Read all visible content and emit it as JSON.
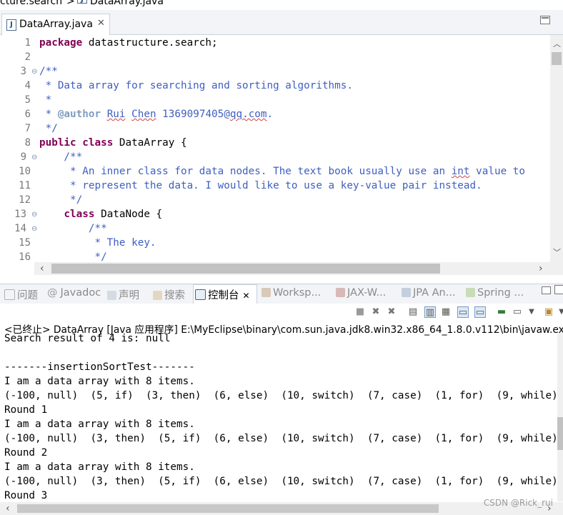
{
  "breadcrumb": {
    "package": "cture.search",
    "separator": ">",
    "file": "DataArray.java"
  },
  "editor_tab": {
    "label": "DataArray.java",
    "close": "✕"
  },
  "code": {
    "line_numbers": [
      "1",
      "2",
      "3",
      "4",
      "5",
      "6",
      "7",
      "8",
      "9",
      "10",
      "11",
      "12",
      "13",
      "14",
      "15",
      "16"
    ],
    "l1": {
      "kw": "package",
      "rest": " datastructure.search;"
    },
    "l3": "/**",
    "l4": " * Data array for searching and sorting algorithms.",
    "l5": " *",
    "l6": {
      "pre": " * ",
      "tag": "@author",
      "sp1": " ",
      "name1": "Rui",
      "sp2": " ",
      "name2": "Chen",
      "mid": " 1369097405@",
      "email": "qq.com",
      "end": "."
    },
    "l7": " */",
    "l8": {
      "kw1": "public",
      "sp": " ",
      "kw2": "class",
      "rest": " DataArray {"
    },
    "l9": "    /**",
    "l10": {
      "pre": "     * An inner class for data nodes. The text book usually use an ",
      "int": "int",
      "post": " value to"
    },
    "l11": "     * represent the data. I would like to use a key-value pair instead.",
    "l12": "     */",
    "l13": {
      "indent": "    ",
      "kw": "class",
      "rest": " DataNode {"
    },
    "l14": "        /**",
    "l15": "         * The key.",
    "l16": "         */"
  },
  "panel_tabs": [
    "问题",
    "Javadoc",
    "声明",
    "搜索",
    "控制台",
    "Worksp...",
    "JAX-W...",
    "JPA An...",
    "Spring ..."
  ],
  "console": {
    "header": "<已终止> DataArray [Java 应用程序] E:\\MyEclipse\\binary\\com.sun.java.jdk8.win32.x86_64_1.8.0.v112\\bin\\javaw.exe",
    "lines": [
      "Search result of 4 is: null",
      "",
      "-------insertionSortTest-------",
      "I am a data array with 8 items.",
      "(-100, null)  (5, if)  (3, then)  (6, else)  (10, switch)  (7, case)  (1, for)  (9, while)",
      "Round 1",
      "I am a data array with 8 items.",
      "(-100, null)  (3, then)  (5, if)  (6, else)  (10, switch)  (7, case)  (1, for)  (9, while)",
      "Round 2",
      "I am a data array with 8 items.",
      "(-100, null)  (3, then)  (5, if)  (6, else)  (10, switch)  (7, case)  (1, for)  (9, while)",
      "Round 3"
    ]
  },
  "watermark": "CSDN @Rick_rui",
  "colors": {
    "keyword": "#7f0055",
    "comment": "#3f5fbf",
    "javadoc_tag": "#7f9fbf"
  }
}
